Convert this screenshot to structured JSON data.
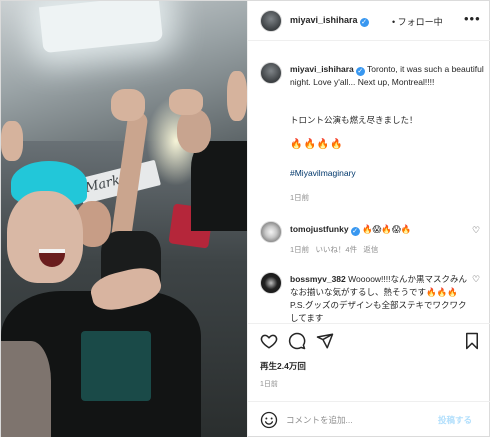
{
  "header": {
    "username": "miyavi_ishihara",
    "separator": "•",
    "follow_label": "フォロー中",
    "more_icon": "more-icon"
  },
  "caption": {
    "username": "miyavi_ishihara",
    "text": "Toronto, it was such a beautiful night. Love y'all... Next up, Montreal!!!!",
    "text_jp": "トロント公演も燃え尽きました！",
    "emoji": "🔥🔥🔥🔥",
    "hashtag": "#Miyavilmaginary",
    "time": "1日前"
  },
  "comments": [
    {
      "username": "tomojustfunky",
      "text": "🔥😱🔥😱🔥",
      "time": "1日前",
      "likes": "いいね！4件",
      "reply_label": "返信"
    },
    {
      "username": "bossmyv_382",
      "text": "Woooow!!!!なんか黒マスクみんなお揃いな気がするし、熱そうです🔥🔥🔥P.S.グッズのデザインも全部ステキでワクワクしてます"
    }
  ],
  "stats": {
    "views": "再生2.4万回",
    "time": "1日前"
  },
  "composer": {
    "placeholder": "コメントを追加...",
    "post_label": "投稿する"
  },
  "colors": {
    "verified": "#3897f0",
    "hashtag": "#00376b",
    "muted": "#8e8e8e",
    "post_disabled": "#b2dffc"
  }
}
